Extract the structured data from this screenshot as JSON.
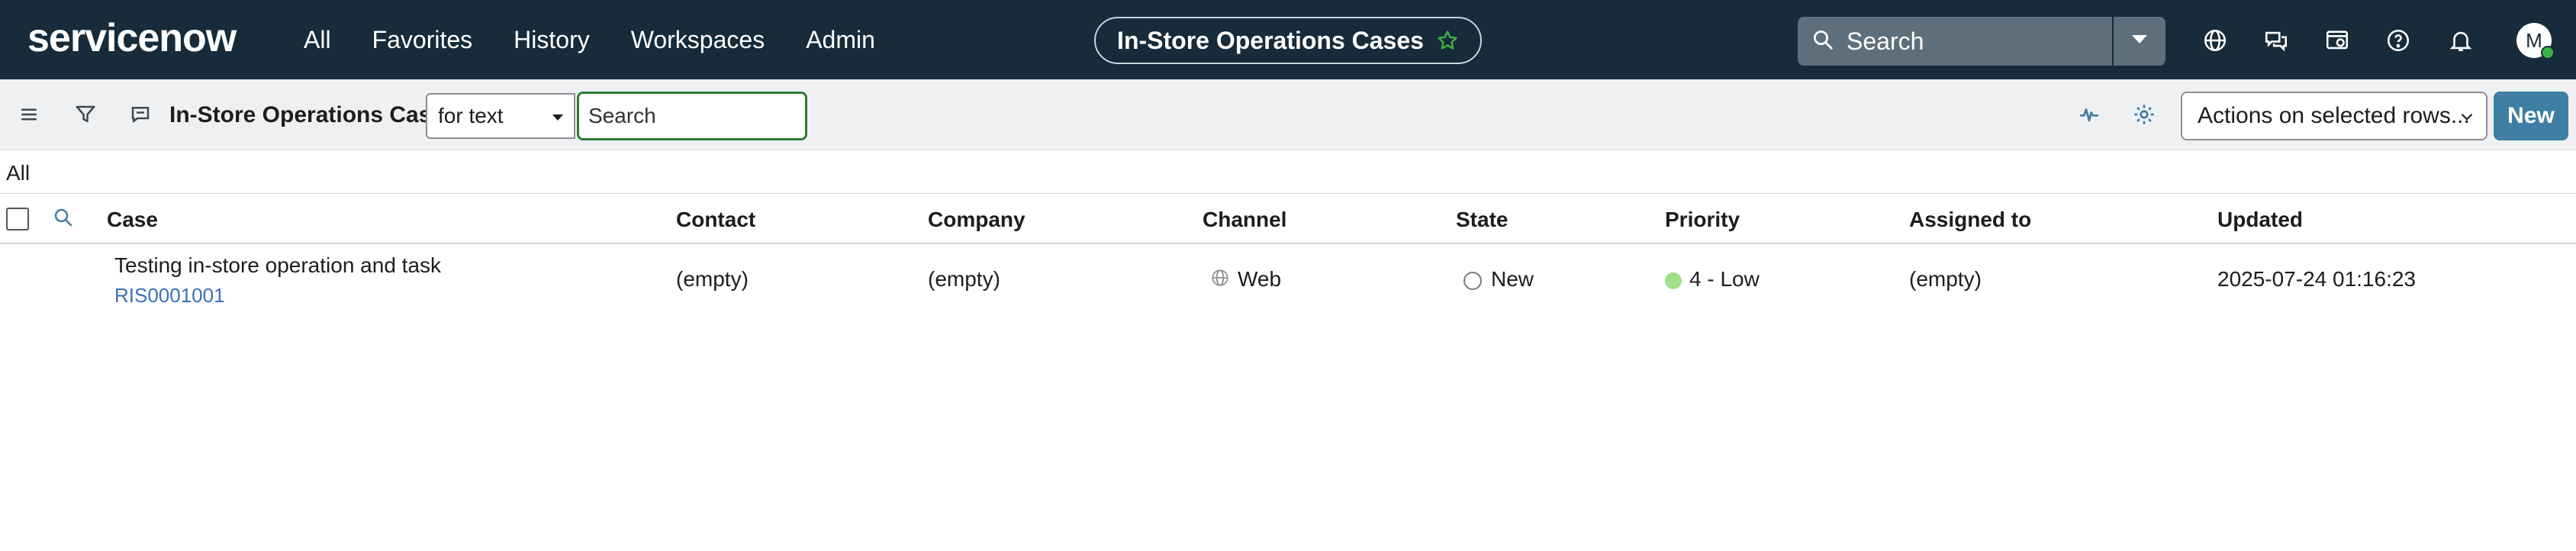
{
  "brand": {
    "logo_text": "servicenow"
  },
  "nav": {
    "items": [
      "All",
      "Favorites",
      "History",
      "Workspaces",
      "Admin"
    ]
  },
  "context_title": "In-Store Operations Cases",
  "global_search": {
    "placeholder": "Search"
  },
  "user": {
    "avatar_initial": "M"
  },
  "toolbar": {
    "list_title": "In-Store Operations Cases",
    "search_field": "for text",
    "search_placeholder": "Search",
    "actions_label": "Actions on selected rows...",
    "new_label": "New"
  },
  "breadcrumb": "All",
  "table": {
    "columns": [
      "Case",
      "Contact",
      "Company",
      "Channel",
      "State",
      "Priority",
      "Assigned to",
      "Updated"
    ],
    "rows": [
      {
        "case_title": "Testing in-store operation and task",
        "case_number": "RIS0001001",
        "contact": "(empty)",
        "company": "(empty)",
        "channel": "Web",
        "state": "New",
        "priority": "4 - Low",
        "assigned_to": "(empty)",
        "updated": "2025-07-24 01:16:23"
      }
    ]
  },
  "colors": {
    "nav_bg": "#172b3a",
    "accent_green": "#2e7d32",
    "new_button": "#3e7fa3",
    "link": "#3d6fb5",
    "priority_low": "#9fe08a",
    "star": "#3cb043"
  }
}
